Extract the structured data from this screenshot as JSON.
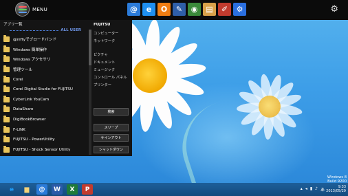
{
  "topbar": {
    "menu_label": "MENU",
    "launchers": [
      {
        "name": "nifty-icon",
        "glyph": "@",
        "color": "#2b7bd9"
      },
      {
        "name": "ie-icon",
        "glyph": "e",
        "color": "#1e8ff0"
      },
      {
        "name": "office-icon",
        "glyph": "O",
        "color": "#f07d12"
      },
      {
        "name": "word-icon",
        "glyph": "✎",
        "color": "#2f5fa8"
      },
      {
        "name": "globe-icon",
        "glyph": "◉",
        "color": "#3a8a3a"
      },
      {
        "name": "notebook-icon",
        "glyph": "▤",
        "color": "#d8a14a"
      },
      {
        "name": "pen-icon",
        "glyph": "✐",
        "color": "#c23b2e"
      },
      {
        "name": "settings-icon",
        "glyph": "⚙",
        "color": "#2a6fe0"
      }
    ]
  },
  "panel": {
    "apps_title": "アプリ一覧",
    "all_user": "ALL USER",
    "apps": [
      "@niftyでブロードバンド",
      "Windows 簡単操作",
      "Windows アクセサリ",
      "管理ツール",
      "Corel",
      "Corel Digital Studio for FUJITSU",
      "CyberLink YouCam",
      "DataShare",
      "DigiBookBrowser",
      "F-LINK",
      "FUJITSU - PowerUtility",
      "FUJITSU - Shock Sensor Utility"
    ],
    "brand": "FUJITSU",
    "links_top": [
      "コンピューター",
      "ネットワーク"
    ],
    "links_mid": [
      "ピクチャ",
      "ドキュメント",
      "ミュージック",
      "コントロール パネル",
      "プリンター"
    ],
    "search": "検索",
    "sleep": "スリープ",
    "signout": "サインアウト",
    "shutdown": "シャットダウン"
  },
  "watermark": {
    "line1": "Windows 8",
    "line2": "Build 9200"
  },
  "taskbar": {
    "apps": [
      {
        "name": "ie-taskbar-icon",
        "glyph": "e",
        "color": "#1e9af5",
        "bg": "transparent"
      },
      {
        "name": "explorer-taskbar-icon",
        "glyph": "▆",
        "color": "#f2d27a",
        "bg": "transparent"
      },
      {
        "name": "nifty-taskbar-icon",
        "glyph": "@",
        "color": "#fff",
        "bg": "#2b7bd9"
      },
      {
        "name": "word-taskbar-icon",
        "glyph": "W",
        "color": "#fff",
        "bg": "#2b5aa8"
      },
      {
        "name": "excel-taskbar-icon",
        "glyph": "X",
        "color": "#fff",
        "bg": "#1f7a3a"
      },
      {
        "name": "pdf-taskbar-icon",
        "glyph": "P",
        "color": "#fff",
        "bg": "#c23b2e"
      }
    ],
    "tray": [
      "▴",
      "◂",
      "▮",
      "♪",
      "あ"
    ],
    "time": "9:33",
    "date": "2013/05/29"
  }
}
